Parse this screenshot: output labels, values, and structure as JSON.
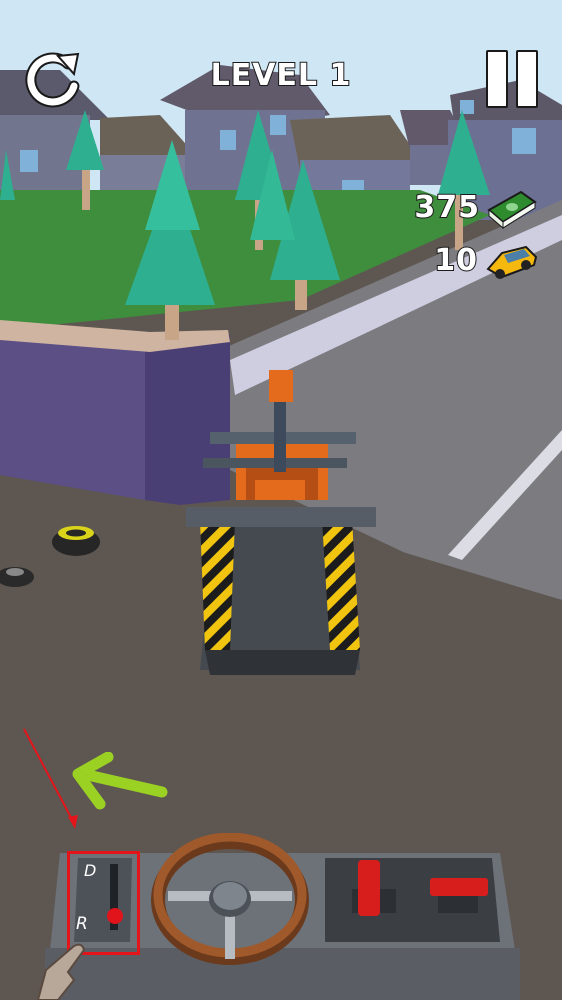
{
  "hud": {
    "level_label": "LEVEL 1",
    "money": "375",
    "cars": "10"
  },
  "controls": {
    "gear_drive": "D",
    "gear_reverse": "R"
  },
  "icons": {
    "restart": "restart-icon",
    "pause": "pause-icon",
    "money": "cash-stack-icon",
    "cars": "taxi-car-icon",
    "arrow": "hint-arrow-icon",
    "hand": "tutorial-hand-icon"
  },
  "colors": {
    "grass": "#3e8e3d",
    "road": "#7b7b80",
    "ground": "#5e5751",
    "wall": "#5b4f86",
    "tree": "#2eaf90",
    "truck_orange": "#e46b1c",
    "hint_arrow": "#9bd123",
    "highlight": "#e4141b",
    "lever_red": "#d81d1d"
  }
}
